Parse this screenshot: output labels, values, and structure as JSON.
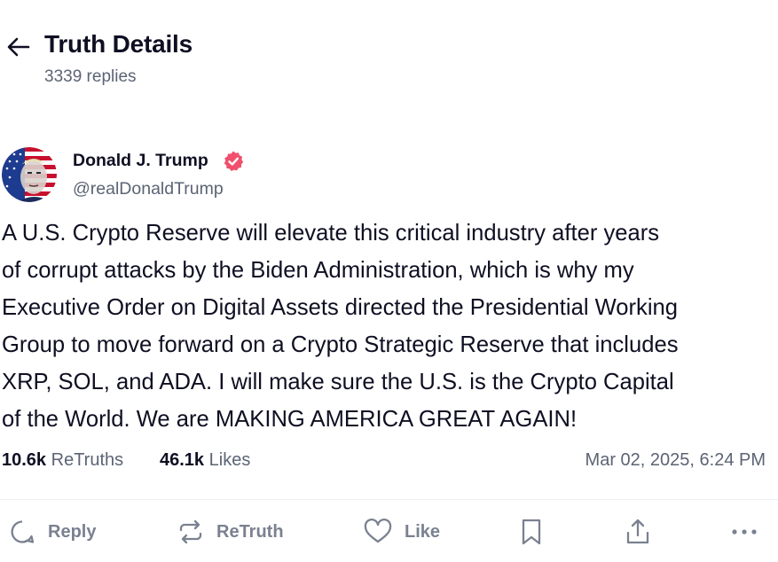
{
  "header": {
    "title": "Truth Details",
    "replies": "3339 replies"
  },
  "author": {
    "name": "Donald J. Trump",
    "handle": "@realDonaldTrump",
    "verified": true
  },
  "post": {
    "text": "A U.S. Crypto Reserve will elevate this critical industry after years\nof corrupt attacks by the Biden Administration, which is why my\nExecutive Order on Digital Assets directed the Presidential Working\nGroup to move forward on a Crypto Strategic Reserve that includes\nXRP, SOL, and ADA. I will make sure the U.S. is the Crypto Capital\nof the World. We are MAKING AMERICA GREAT AGAIN!"
  },
  "stats": {
    "retruths_count": "10.6k",
    "retruths_label": "ReTruths",
    "likes_count": "46.1k",
    "likes_label": "Likes",
    "timestamp": "Mar 02, 2025, 6:24 PM"
  },
  "actions": {
    "reply": "Reply",
    "retruth": "ReTruth",
    "like": "Like"
  },
  "colors": {
    "text_primary": "#0f0f23",
    "text_secondary": "#5b6474",
    "action_gray": "#7a8190",
    "verified_badge": "#f0506e"
  },
  "icons": [
    "arrow-left-icon",
    "verified-icon",
    "reply-icon",
    "retruth-icon",
    "heart-icon",
    "bookmark-icon",
    "share-icon",
    "more-icon"
  ]
}
